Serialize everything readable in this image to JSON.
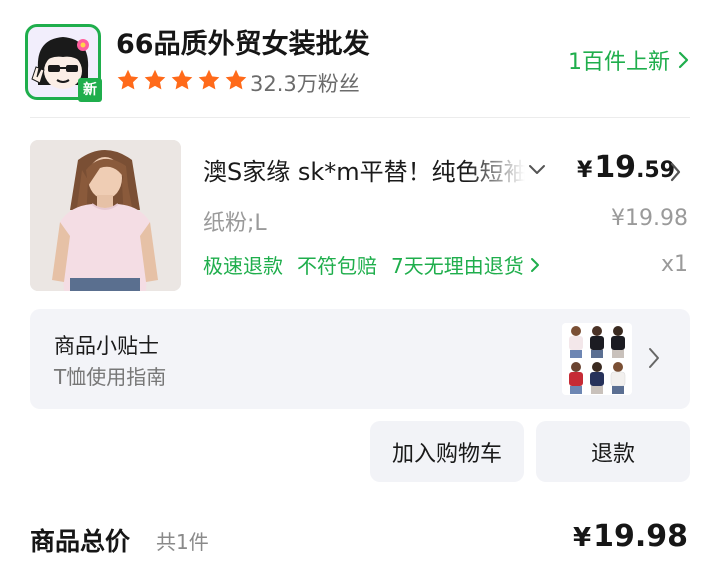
{
  "store": {
    "name": "66品质外贸女装批发",
    "avatar_badge": "新",
    "avatar_icon": "cartoon-avatar",
    "rating_stars": 5,
    "fans": "32.3万粉丝",
    "new_arrivals": "1百件上新"
  },
  "product": {
    "title": "澳S家缘 sk*m平替！纯色短袖",
    "price_symbol": "¥",
    "price_int": "19",
    "price_dec": ".59",
    "sku": "纸粉;L",
    "original_price": "¥19.98",
    "quantity": "x1",
    "services": [
      "极速退款",
      "不符包赔",
      "7天无理由退货"
    ]
  },
  "tips": {
    "title": "商品小贴士",
    "subtitle": "T恤使用指南"
  },
  "actions": {
    "add_to_cart": "加入购物车",
    "refund": "退款"
  },
  "total": {
    "label": "商品总价",
    "count": "共1件",
    "price_symbol": "¥",
    "price_value": "19.98"
  },
  "colors": {
    "accent_green": "#1fae4c",
    "star_orange": "#ff6a1a",
    "panel_bg": "#f3f4f8"
  }
}
